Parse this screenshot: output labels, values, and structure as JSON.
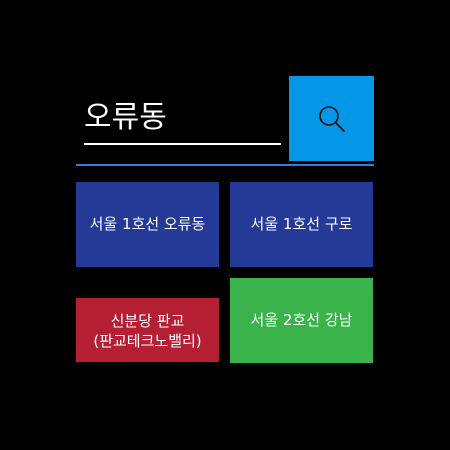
{
  "search": {
    "value": "오류동",
    "button_icon": "search-icon"
  },
  "colors": {
    "background": "#000000",
    "search_button": "#0497e8",
    "divider": "#2f7fd8",
    "tile_blue": "#243a96",
    "tile_red": "#b51f34",
    "tile_green": "#3ab44a"
  },
  "results": [
    {
      "label": "서울 1호선 오류동",
      "color": "#243a96"
    },
    {
      "label": "서울 1호선 구로",
      "color": "#243a96"
    },
    {
      "label": "신분당 판교(판교테크노밸리)",
      "color": "#b51f34"
    },
    {
      "label": "서울 2호선 강남",
      "color": "#3ab44a"
    }
  ]
}
